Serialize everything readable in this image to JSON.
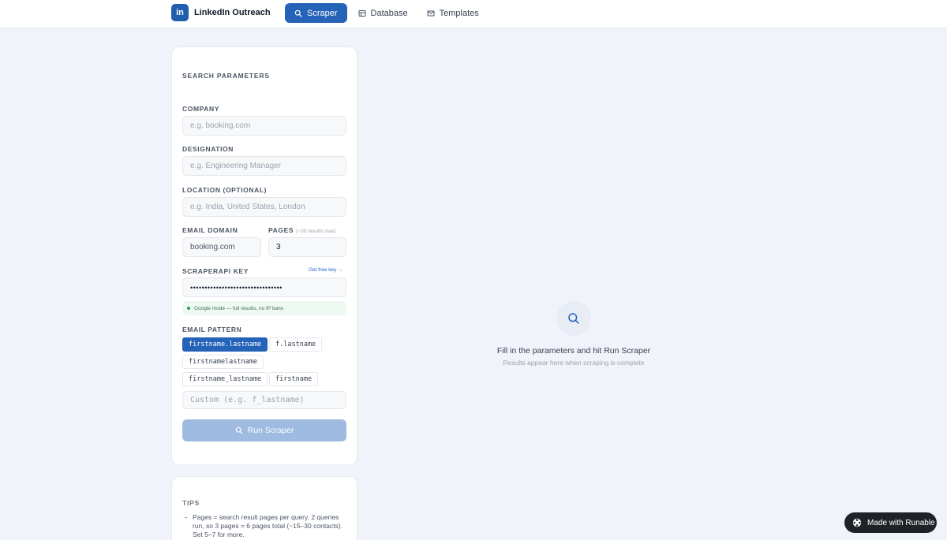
{
  "app": {
    "brand_logo": "in",
    "brand_name": "LinkedIn Outreach",
    "accent_color": "#2563b8"
  },
  "nav": {
    "tabs": [
      {
        "label": "Scraper",
        "icon": "search-icon",
        "active": true
      },
      {
        "label": "Database",
        "icon": "database-icon",
        "active": false
      },
      {
        "label": "Templates",
        "icon": "mail-icon",
        "active": false
      }
    ]
  },
  "params": {
    "section_title": "SEARCH PARAMETERS",
    "company": {
      "label": "COMPANY",
      "placeholder": "e.g. booking.com"
    },
    "designation": {
      "label": "DESIGNATION",
      "placeholder": "e.g. Engineering Manager"
    },
    "location": {
      "label": "LOCATION (OPTIONAL)",
      "placeholder": "e.g. India, United States, London"
    },
    "email_domain": {
      "label": "EMAIL DOMAIN",
      "value": "booking.com"
    },
    "pages": {
      "label": "PAGES",
      "hint": "(~30 results max)",
      "value": "3"
    },
    "api_key": {
      "label": "SCRAPERAPI KEY",
      "link": "Get free key →",
      "value": "••••••••••••••••••••••••••••••••"
    },
    "status": "Google mode — full results, no IP bans",
    "email_pattern": {
      "label": "EMAIL PATTERN",
      "chips": [
        "firstname.lastname",
        "f.lastname",
        "firstnamelastname",
        "firstname_lastname",
        "firstname"
      ],
      "selected": "firstname.lastname",
      "custom_placeholder": "Custom (e.g. f_lastname)"
    },
    "run_button": "Run Scraper"
  },
  "tips": {
    "title": "TIPS",
    "items": [
      "Pages = search result pages per query. 2 queries run, so 3 pages = 6 pages total (~15–30 contacts). Set 5–7 for more."
    ]
  },
  "empty_state": {
    "icon": "search-icon",
    "title": "Fill in the parameters and hit Run Scraper",
    "subtitle": "Results appear here when scraping is complete"
  },
  "badge": {
    "label": "Made with Runable",
    "icon": "runable-logo-icon"
  }
}
